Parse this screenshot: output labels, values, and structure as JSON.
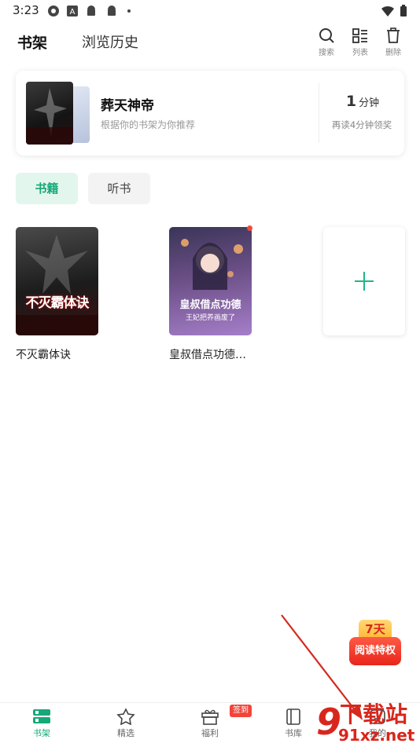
{
  "status_bar": {
    "time": "3:23"
  },
  "header": {
    "tabs": [
      {
        "label": "书架",
        "active": true
      },
      {
        "label": "浏览历史",
        "active": false
      }
    ],
    "actions": {
      "search": "搜索",
      "list": "列表",
      "delete": "删除"
    }
  },
  "recommendation": {
    "title": "葬天神帝",
    "subtitle": "根据你的书架为你推荐",
    "minutes": "1",
    "minutes_unit": "分钟",
    "reward_note": "再读4分钟领奖"
  },
  "filters": {
    "books": "书籍",
    "audio": "听书"
  },
  "books": [
    {
      "title": "不灭霸体诀",
      "cover_title": "不灭霸体诀",
      "has_update": false
    },
    {
      "title": "皇叔借点功德…",
      "cover_title": "皇叔借点功德",
      "cover_subtitle": "王妃把养画废了",
      "has_update": true
    }
  ],
  "promo": {
    "top": "7天",
    "bottom": "阅读特权"
  },
  "bottom_nav": {
    "items": [
      {
        "label": "书架",
        "active": true
      },
      {
        "label": "精选"
      },
      {
        "label": "福利"
      },
      {
        "label": "书库"
      },
      {
        "label": "我的"
      }
    ],
    "welfare_badge": "签到"
  },
  "watermark": {
    "brand": "下载站",
    "url": "91xz.net",
    "logo": "9"
  },
  "colors": {
    "accent": "#16a878",
    "badge": "#f2443a",
    "watermark": "#d9261c"
  }
}
